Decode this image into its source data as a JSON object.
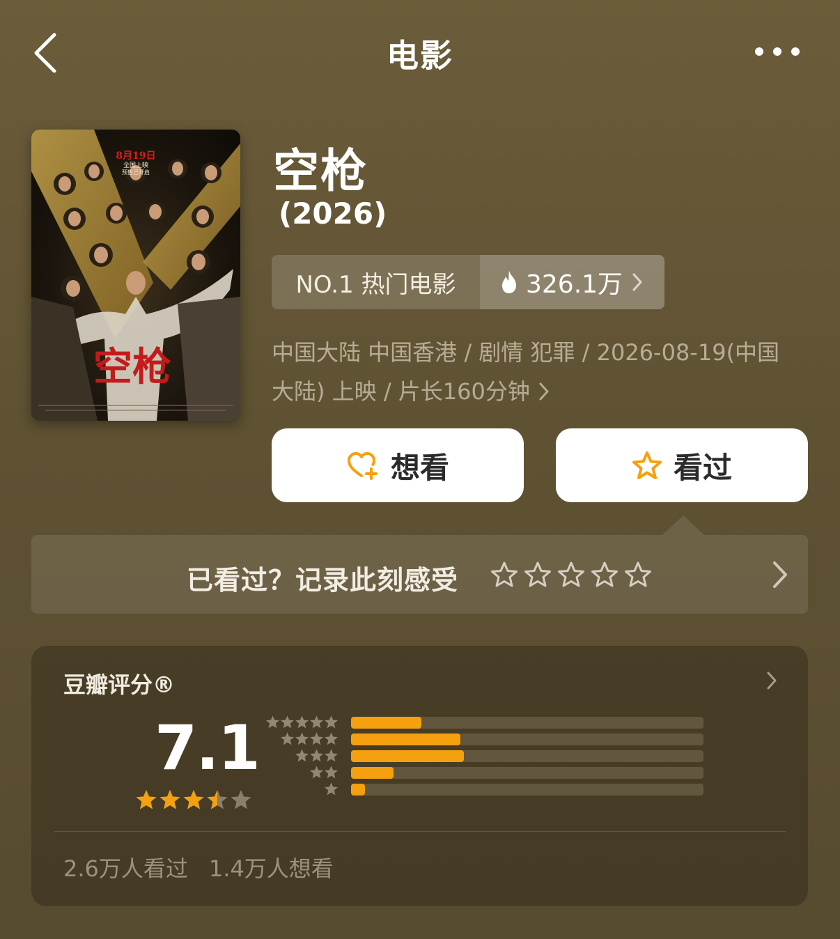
{
  "nav": {
    "title": "电影",
    "back_icon": "chevron-left-icon",
    "more_icon": "more-dots-icon"
  },
  "movie": {
    "title": "空枪",
    "year": "(2026)",
    "poster": {
      "release_date": "8月19日",
      "release_line1": "全国上映",
      "release_line2": "预售已开启",
      "title_art": "空枪"
    },
    "rank": {
      "label": "NO.1 热门电影",
      "heat": "326.1万",
      "heat_icon": "flame-icon"
    },
    "meta_line1": "中国大陆 中国香港 / 剧情 犯罪 / 2026-08-19(中国",
    "meta_line2": "大陆) 上映 / 片长160分钟"
  },
  "actions": {
    "want_label": "想看",
    "seen_label": "看过",
    "accent": "#f5a00f"
  },
  "record": {
    "prompt": "已看过？记录此刻感受",
    "star_count": 5
  },
  "rating": {
    "title": "豆瓣评分®",
    "score": "7.1",
    "stars_filled": 3.5,
    "stars_total": 5,
    "distribution": [
      {
        "stars": 5,
        "fraction": 0.2
      },
      {
        "stars": 4,
        "fraction": 0.31
      },
      {
        "stars": 3,
        "fraction": 0.32
      },
      {
        "stars": 2,
        "fraction": 0.12
      },
      {
        "stars": 1,
        "fraction": 0.04
      }
    ],
    "watched": "2.6万人看过",
    "wanted": "1.4万人想看"
  }
}
